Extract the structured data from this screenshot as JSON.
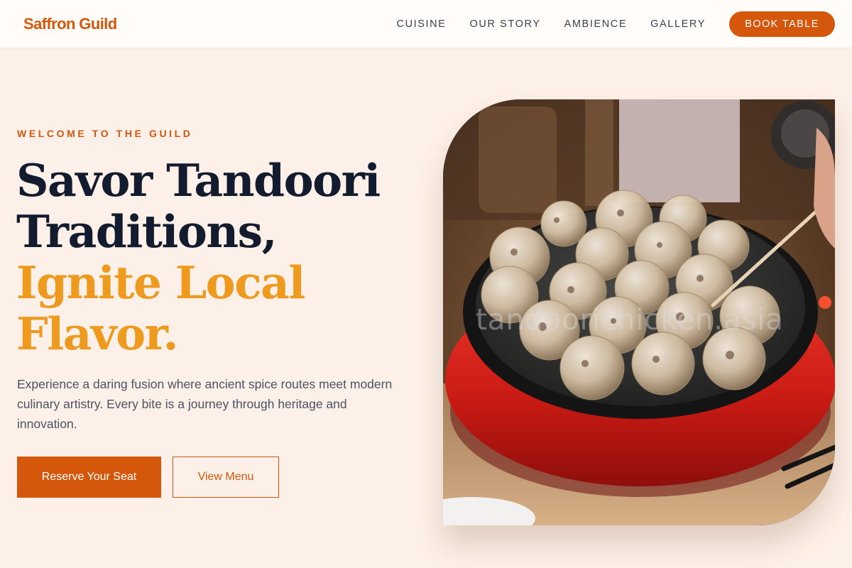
{
  "header": {
    "brand": "Saffron Guild",
    "nav": [
      "CUISINE",
      "OUR STORY",
      "AMBIENCE",
      "GALLERY"
    ],
    "cta": "BOOK TABLE"
  },
  "hero": {
    "eyebrow": "WELCOME TO THE GUILD",
    "headline_line1": "Savor Tandoori",
    "headline_line2": "Traditions,",
    "headline_accent1": "Ignite Local",
    "headline_accent2": "Flavor.",
    "description": "Experience a daring fusion where ancient spice routes meet modern culinary artistry. Every bite is a journey through heritage and innovation.",
    "primary_button": "Reserve Your Seat",
    "secondary_button": "View Menu",
    "image_watermark": "tandoorichicken.asia"
  },
  "colors": {
    "brand": "#d4570b",
    "accent": "#ee9a1e",
    "heading": "#131b2e",
    "background": "#fdf0e8"
  }
}
